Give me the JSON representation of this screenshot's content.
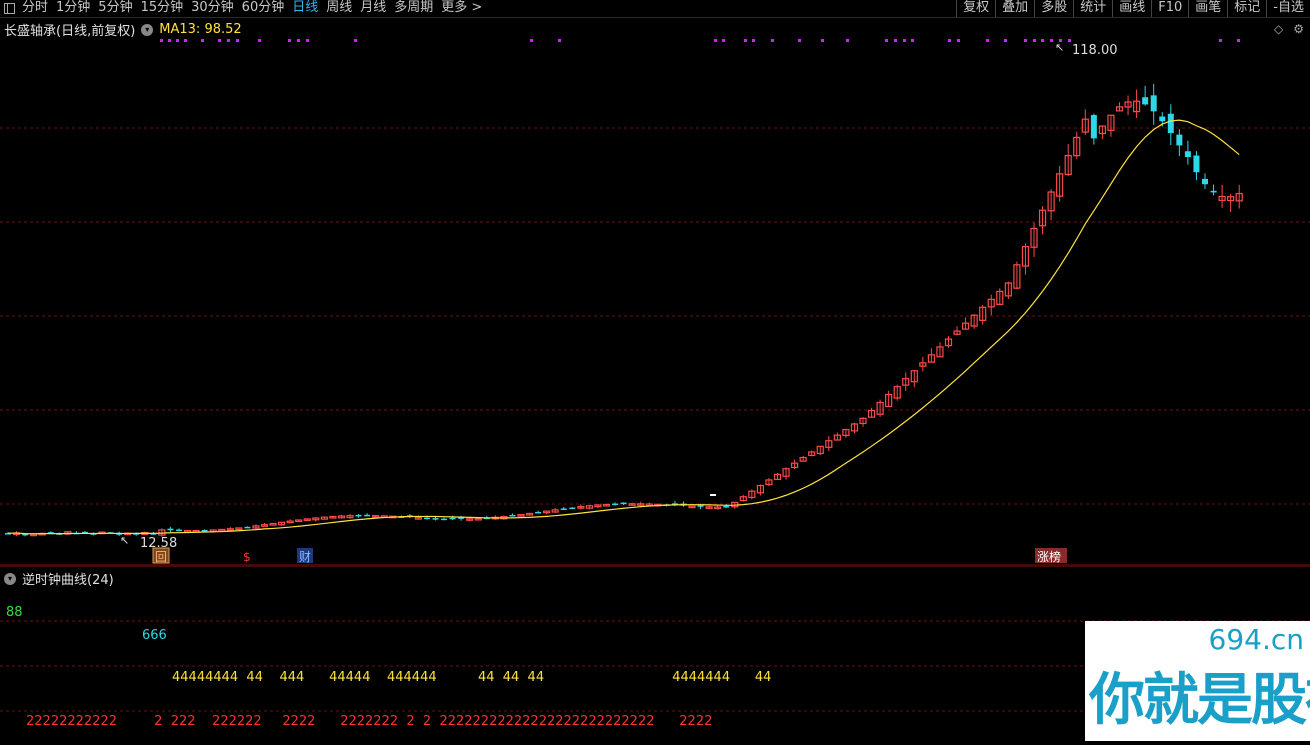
{
  "toolbar": {
    "periods": [
      "分时",
      "1分钟",
      "5分钟",
      "15分钟",
      "30分钟",
      "60分钟",
      "日线",
      "周线",
      "月线",
      "多周期",
      "更多 >"
    ],
    "active_period": "日线",
    "right_items": [
      "复权",
      "叠加",
      "多股",
      "统计",
      "画线",
      "F10",
      "画笔",
      "标记",
      "-自选"
    ]
  },
  "main": {
    "stock_title": "长盛轴承(日线,前复权)",
    "ma_label": "MA13: 98.52",
    "high_label": "118.00",
    "low_label": "12.58",
    "markers": [
      {
        "text": "回",
        "color": "#ffb070"
      },
      {
        "text": "$",
        "color": "#ff3030"
      },
      {
        "text": "财",
        "color": "#8fb6ff"
      },
      {
        "text": "涨榜",
        "color": "#ffffff"
      }
    ],
    "colors": {
      "up": "#ff4a4a",
      "down": "#2ed8e6",
      "ma": "#ffe23c",
      "grid": "#6b1010",
      "dots": "#c828f0"
    }
  },
  "sub": {
    "title": "逆时钟曲线(24)",
    "rows": [
      {
        "text": "88",
        "color": "#33dd44"
      },
      {
        "text": "666",
        "color": "#2ed8e6"
      },
      {
        "text": "44444444  44    444      44444    444444          44  44  44                               4444444      44",
        "color": "#ffe23c"
      },
      {
        "text": "22222222222         2  222    222222     2222      2222222  2  2  22222222222222222222222222      2222",
        "color": "#ff3030"
      }
    ]
  },
  "watermark": {
    "site": "694.cn",
    "main": "你就是股神"
  }
}
